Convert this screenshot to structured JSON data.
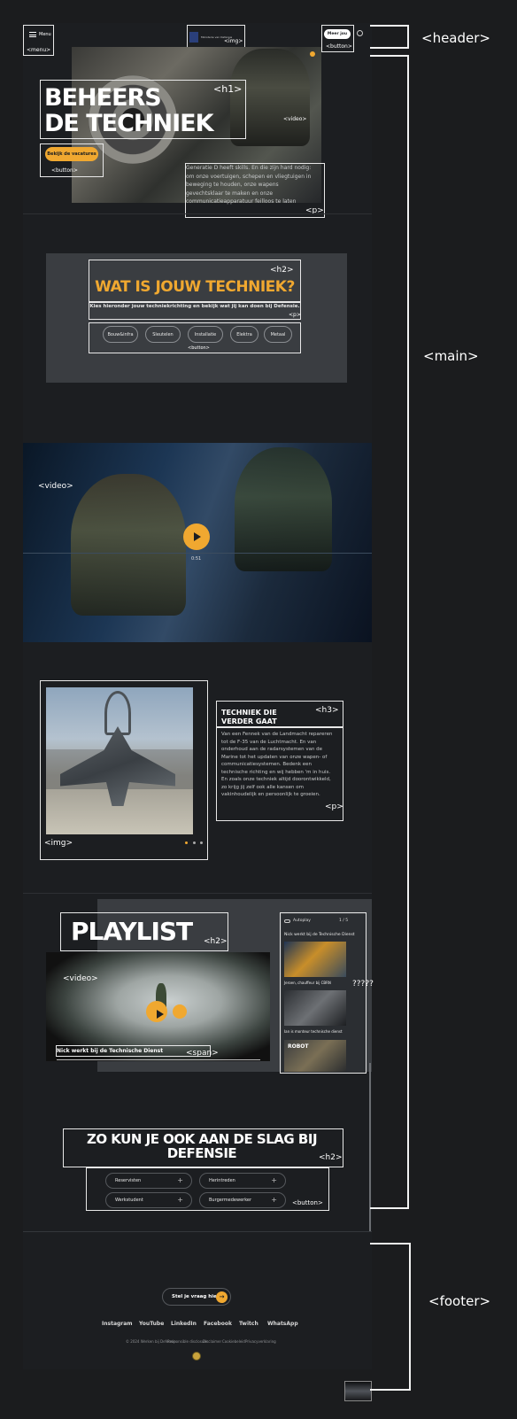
{
  "annotations": {
    "header": "<header>",
    "main": "<main>",
    "footer": "<footer>",
    "menu": "<menu>",
    "img": "<img>",
    "button": "<button>",
    "h1": "<h1>",
    "video": "<video>",
    "p": "<p>",
    "h2": "<h2>",
    "h3": "<h3>",
    "span": "<span>",
    "unknown": "?????"
  },
  "header": {
    "menu_label": "Menu",
    "logo_text": "Ministerie van Defensie",
    "cta_label": "Meer jou"
  },
  "hero": {
    "title_line1": "BEHEERS",
    "title_line2": "DE TECHNIEK",
    "button_label": "Bekijk de vacatures",
    "paragraph": "Generatie D heeft skills. En die zijn hard nodig: om onze voertuigen, schepen en vliegtuigen in beweging te houden, onze wapens gevechtsklaar te maken en onze communicatieapparatuur feilloos te laten werken. Ben jij klaar voor next"
  },
  "techniek": {
    "title": "WAT IS JOUW TECHNIEK?",
    "subtitle": "Kies hieronder jouw techniekrichting en bekijk wat jij kan doen bij Defensie.",
    "options": [
      "Bouw&infra",
      "Sleutelen",
      "Installatie",
      "Elektra",
      "Metaal"
    ]
  },
  "video_feature": {
    "duration": "0:51"
  },
  "carousel": {
    "title": "TECHNIEK DIE VERDER GAAT",
    "paragraph": "Van een Fennek van de Landmacht repareren tot de F-35 van de Luchtmacht. En van onderhoud aan de radarsystemen van de Marine tot het updaten van onze wapen- of communicatiesystemen. Bedenk een technische richting en wij hebben 'm in huis. En zoals onze techniek altijd doorontwikkeld, zo krijg jij zelf ook alle kansen om vakinhoudelijk en persoonlijk te groeien."
  },
  "playlist": {
    "title": "PLAYLIST",
    "caption": "Nick werkt bij de Technische Dienst",
    "autoplay_label": "Autoplay",
    "counter": "1 / 5",
    "current": "Nick werkt bij de Technische Dienst",
    "items": [
      "Jeroen, chauffeur bij CBRN",
      "Ian is monteur technische dienst",
      "ROBOT"
    ]
  },
  "slag": {
    "title": "ZO KUN JE OOK AAN DE SLAG BIJ DEFENSIE",
    "options": [
      "Reservisten",
      "Herintreden",
      "Werkstudent",
      "Burgermedewerker"
    ]
  },
  "footer": {
    "ask_label": "Stel je vraag hier",
    "socials": [
      "Instagram",
      "YouTube",
      "LinkedIn",
      "Facebook",
      "Twitch",
      "WhatsApp"
    ],
    "legal": [
      "© 2024 Werken bij Defensie",
      "Responsible disclosure",
      "Disclaimer",
      "Cookiebeleid",
      "Privacyverklaring"
    ]
  },
  "colors": {
    "accent": "#f0a830",
    "background": "#1b1c1e",
    "panel": "#3a3d41"
  }
}
